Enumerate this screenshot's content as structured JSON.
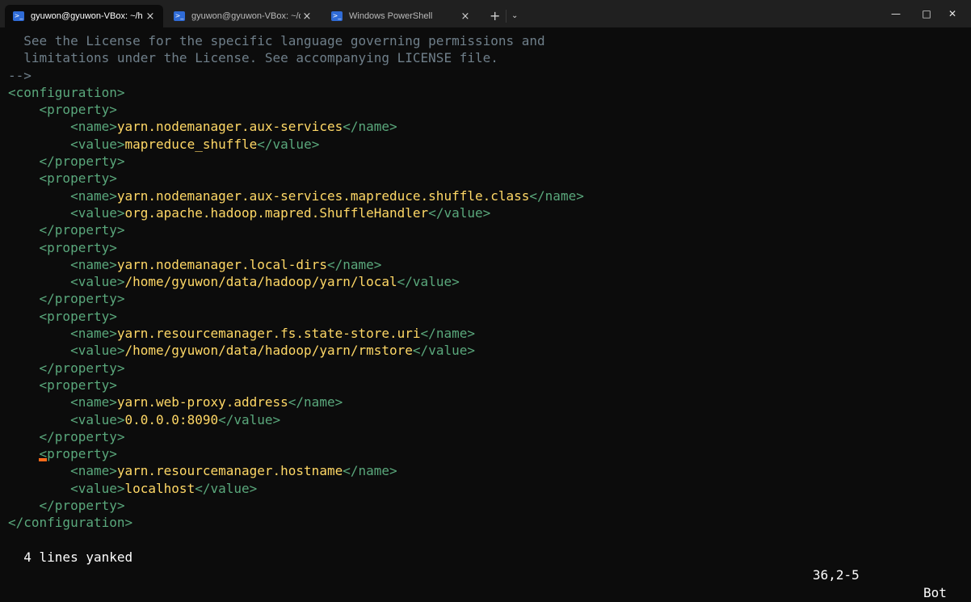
{
  "tabs": [
    {
      "label": "gyuwon@gyuwon-VBox: ~/h",
      "active": true
    },
    {
      "label": "gyuwon@gyuwon-VBox: ~/da",
      "active": false
    },
    {
      "label": "Windows PowerShell",
      "active": false
    }
  ],
  "icons": {
    "tab_icon": "powershell-icon",
    "close": "×",
    "new_tab": "+",
    "dropdown": "⌄",
    "minimize": "—",
    "maximize": "□",
    "window_close": "✕"
  },
  "colors": {
    "background": "#0c0c0c",
    "text": "#ffd866",
    "tag": "#5aa87c",
    "comment": "#6f7f8a",
    "cursor": "#ff6a1a"
  },
  "editor": {
    "comment_lines": [
      "  See the License for the specific language governing permissions and",
      "  limitations under the License. See accompanying LICENSE file.",
      "-->"
    ],
    "config_open": "<configuration>",
    "property_open": "<property>",
    "property_close": "</property>",
    "name_open": "<name>",
    "name_close": "</name>",
    "value_open": "<value>",
    "value_close": "</value>",
    "config_close": "</configuration>",
    "properties": [
      {
        "name": "yarn.nodemanager.aux-services",
        "value": "mapreduce_shuffle"
      },
      {
        "name": "yarn.nodemanager.aux-services.mapreduce.shuffle.class",
        "value": "org.apache.hadoop.mapred.ShuffleHandler"
      },
      {
        "name": "yarn.nodemanager.local-dirs",
        "value": "/home/gyuwon/data/hadoop/yarn/local"
      },
      {
        "name": "yarn.resourcemanager.fs.state-store.uri",
        "value": "/home/gyuwon/data/hadoop/yarn/rmstore"
      },
      {
        "name": "yarn.web-proxy.address",
        "value": "0.0.0.0:8090"
      },
      {
        "name": "yarn.resourcemanager.hostname",
        "value": "localhost"
      }
    ]
  },
  "status_bar": {
    "message": "4 lines yanked",
    "position": "36,2-5",
    "scroll": "Bot"
  }
}
